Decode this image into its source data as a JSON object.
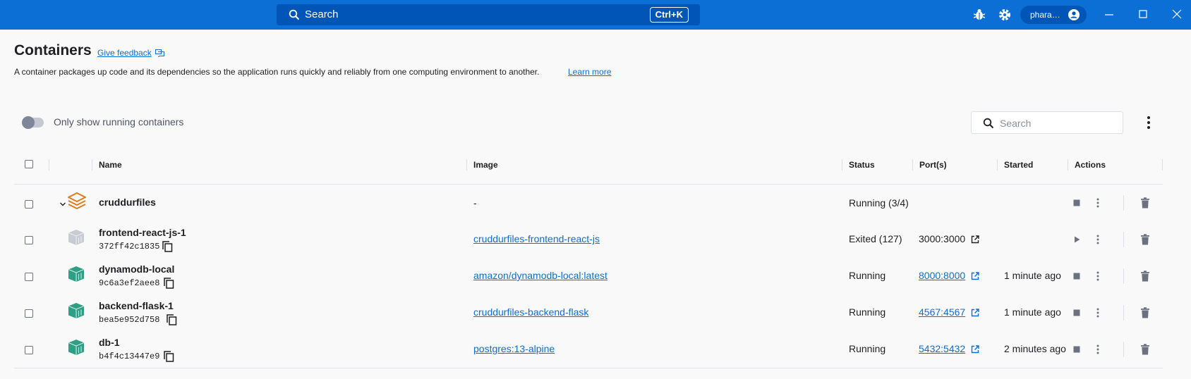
{
  "titlebar": {
    "search_label": "Search",
    "shortcut": "Ctrl+K",
    "user_name": "phara…",
    "accent": "#0b6fd6"
  },
  "page": {
    "title": "Containers",
    "feedback": "Give feedback",
    "description": "A container packages up code and its dependencies so the application runs quickly and reliably from one computing environment to another.",
    "learn_more": "Learn more"
  },
  "toolbar": {
    "toggle_label": "Only show running containers",
    "toggle_on": false,
    "search_placeholder": "Search"
  },
  "table": {
    "headers": {
      "name": "Name",
      "image": "Image",
      "status": "Status",
      "ports": "Port(s)",
      "started": "Started",
      "actions": "Actions"
    },
    "rows": [
      {
        "kind": "group",
        "name": "cruddurfiles",
        "id": "",
        "image": "-",
        "status": "Running (3/4)",
        "port": "",
        "started": "",
        "icon": "stack-icon"
      },
      {
        "kind": "container",
        "name": "frontend-react-js-1",
        "id": "372ff42c1835",
        "image": "cruddurfiles-frontend-react-js",
        "status": "Exited (127)",
        "port": "3000:3000",
        "started": "",
        "icon": "container-gray-icon",
        "running": false
      },
      {
        "kind": "container",
        "name": "dynamodb-local",
        "id": "9c6a3ef2aee8",
        "image": "amazon/dynamodb-local:latest",
        "status": "Running",
        "port": "8000:8000",
        "started": "1 minute ago",
        "icon": "container-green-icon",
        "running": true
      },
      {
        "kind": "container",
        "name": "backend-flask-1",
        "id": "bea5e952d758",
        "image": "cruddurfiles-backend-flask",
        "status": "Running",
        "port": "4567:4567",
        "started": "1 minute ago",
        "icon": "container-green-icon",
        "running": true
      },
      {
        "kind": "container",
        "name": "db-1",
        "id": "b4f4c13447e9",
        "image": "postgres:13-alpine",
        "status": "Running",
        "port": "5432:5432",
        "started": "2 minutes ago",
        "icon": "container-green-icon",
        "running": true
      }
    ]
  }
}
